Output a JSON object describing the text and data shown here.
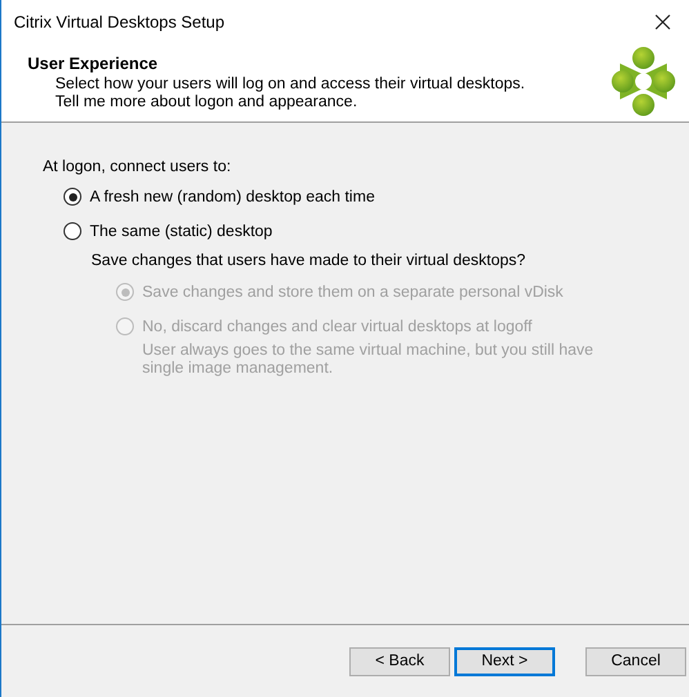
{
  "window": {
    "title": "Citrix Virtual Desktops Setup"
  },
  "header": {
    "title": "User Experience",
    "lines": [
      "Select how your users will log on and access their virtual desktops.",
      "Tell me more about logon and appearance."
    ]
  },
  "prompt": "At logon, connect users to:",
  "options": [
    {
      "label": "A fresh new (random) desktop each time",
      "selected": true,
      "disabled": false
    },
    {
      "label": "The same (static) desktop",
      "selected": false,
      "disabled": false,
      "question": "Save changes that users have made to their virtual desktops?",
      "suboptions": [
        {
          "label": "Save changes and store them on a separate personal vDisk",
          "selected": true,
          "disabled": true
        },
        {
          "label": "No, discard changes and clear virtual desktops at logoff",
          "selected": false,
          "disabled": true,
          "note": "User always goes to the same virtual machine, but you still have single image management."
        }
      ]
    }
  ],
  "buttons": [
    {
      "label": "< Back",
      "default": false
    },
    {
      "label": "Next >",
      "default": true
    },
    {
      "label": "Cancel",
      "default": false
    }
  ]
}
